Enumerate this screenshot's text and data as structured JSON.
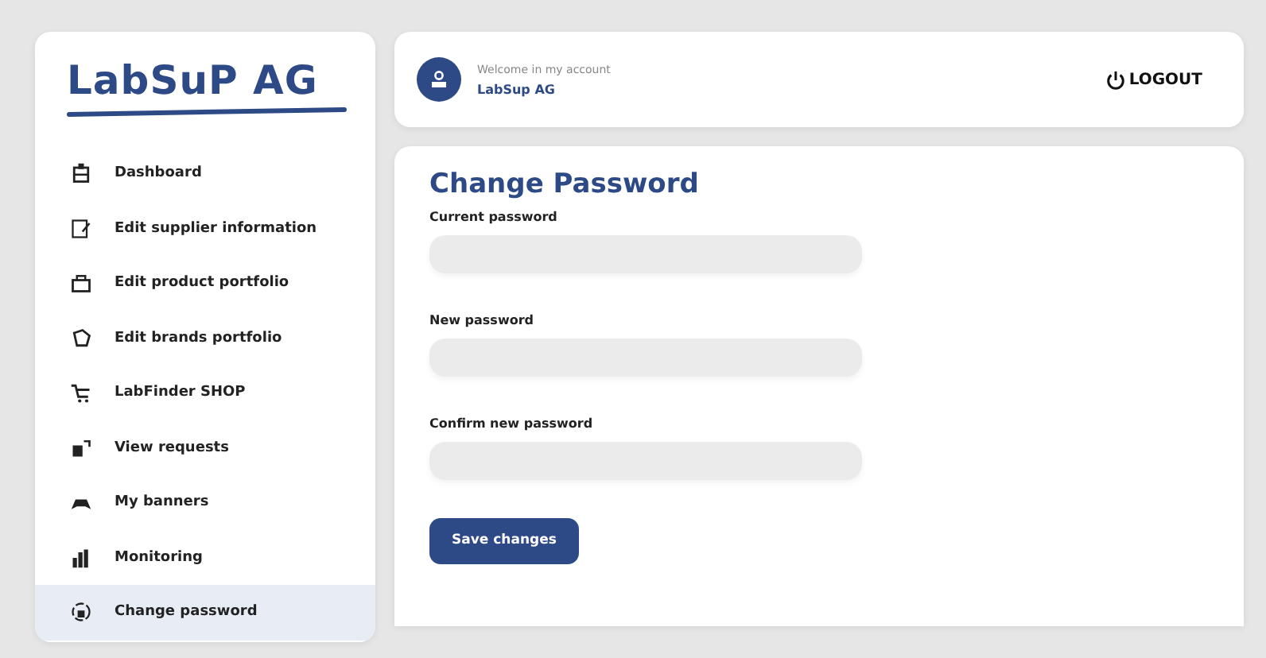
{
  "sidebar": {
    "logo": "LabSuP AG",
    "items": [
      {
        "label": "Dashboard",
        "selected": false
      },
      {
        "label": "Edit supplier information",
        "selected": false
      },
      {
        "label": "Edit product portfolio",
        "selected": false
      },
      {
        "label": "Edit brands portfolio",
        "selected": false
      },
      {
        "label": "LabFinder SHOP",
        "selected": false
      },
      {
        "label": "View requests",
        "selected": false
      },
      {
        "label": "My banners",
        "selected": false
      },
      {
        "label": "Monitoring",
        "selected": false
      },
      {
        "label": "Change password",
        "selected": true
      }
    ]
  },
  "header": {
    "welcome": "Welcome in my account",
    "account": "LabSup AG",
    "logout": "LOGOUT"
  },
  "form": {
    "title": "Change Password",
    "fields": [
      {
        "label": "Current password"
      },
      {
        "label": "New password"
      },
      {
        "label": "Confirm new password"
      }
    ],
    "submit": "Save changes"
  }
}
